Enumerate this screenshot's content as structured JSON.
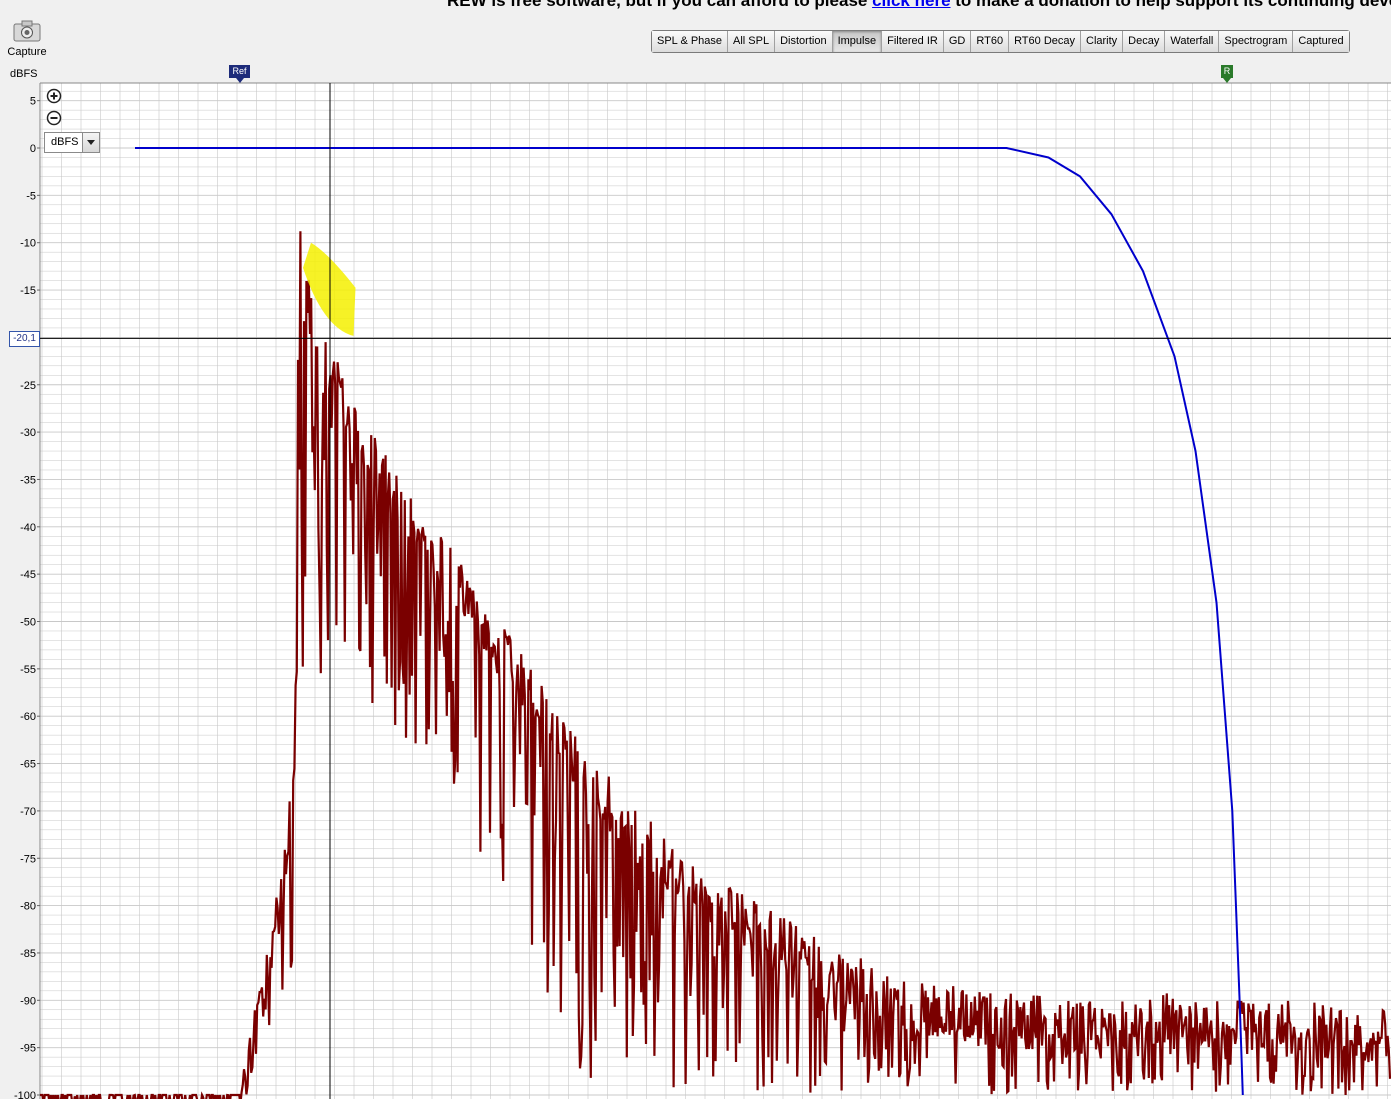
{
  "banner": {
    "text_before": "REW is free software, but if you can afford to please ",
    "link_text": "click here",
    "text_after": " to make a donation to help support its continuing develop"
  },
  "toolbar": {
    "capture_label": "Capture",
    "capture_icon": "camera-icon",
    "tabs": [
      {
        "label": "SPL & Phase",
        "active": false
      },
      {
        "label": "All SPL",
        "active": false
      },
      {
        "label": "Distortion",
        "active": false
      },
      {
        "label": "Impulse",
        "active": true
      },
      {
        "label": "Filtered IR",
        "active": false
      },
      {
        "label": "GD",
        "active": false
      },
      {
        "label": "RT60",
        "active": false
      },
      {
        "label": "RT60 Decay",
        "active": false
      },
      {
        "label": "Clarity",
        "active": false
      },
      {
        "label": "Decay",
        "active": false
      },
      {
        "label": "Waterfall",
        "active": false
      },
      {
        "label": "Spectrogram",
        "active": false
      },
      {
        "label": "Captured",
        "active": false
      }
    ]
  },
  "graph": {
    "unit_label": "dBFS",
    "unit_select_value": "dBFS",
    "cursor_readout": "-20,1",
    "ref_marker": "Ref",
    "right_marker": "R",
    "zoom_in_icon": "zoom-in-icon",
    "zoom_out_icon": "zoom-out-icon",
    "colors": {
      "trace": "#7a0000",
      "window": "#0000cc",
      "highlight": "#f5f000",
      "grid": "#c8c8c8",
      "cursor": "#000000"
    }
  },
  "chart_data": {
    "type": "line",
    "ylim": [
      -100,
      6
    ],
    "y_ticks": [
      "5",
      "0",
      "-5",
      "-10",
      "-15",
      "-20",
      "-25",
      "-30",
      "-35",
      "-40",
      "-45",
      "-50",
      "-55",
      "-60",
      "-65",
      "-70",
      "-75",
      "-80",
      "-85",
      "-90",
      "-95",
      "-100"
    ],
    "y_tick_values": [
      5,
      0,
      -5,
      -10,
      -15,
      -20,
      -25,
      -30,
      -35,
      -40,
      -45,
      -50,
      -55,
      -60,
      -65,
      -70,
      -75,
      -80,
      -85,
      -90,
      -95,
      -100
    ],
    "cursor_y": -20.1,
    "grid": true,
    "series": [
      {
        "type": "impulse-envelope",
        "upper": [
          [
            0,
            -100
          ],
          [
            0.05,
            -96
          ],
          [
            0.15,
            -90
          ],
          [
            0.3,
            -82
          ],
          [
            0.45,
            -72
          ],
          [
            0.52,
            -62
          ],
          [
            0.54,
            -45
          ],
          [
            0.56,
            -0.5
          ],
          [
            0.58,
            -8
          ],
          [
            0.62,
            -10
          ],
          [
            0.7,
            -18
          ],
          [
            0.8,
            -20
          ],
          [
            0.9,
            -22
          ],
          [
            1.0,
            -24
          ],
          [
            1.5,
            -34
          ],
          [
            2.0,
            -42
          ],
          [
            2.6,
            -52
          ],
          [
            3.2,
            -62
          ],
          [
            3.8,
            -70
          ],
          [
            4.4,
            -76
          ],
          [
            5.0,
            -80
          ],
          [
            5.6,
            -84
          ],
          [
            6.4,
            -88
          ],
          [
            7.2,
            -89
          ],
          [
            8.0,
            -90
          ],
          [
            9.0,
            -89
          ],
          [
            10.0,
            -90
          ],
          [
            11.0,
            -91
          ],
          [
            12.0,
            -92
          ]
        ],
        "lower": [
          [
            0,
            -100
          ],
          [
            0.1,
            -100
          ],
          [
            0.3,
            -96
          ],
          [
            0.5,
            -88
          ],
          [
            0.55,
            -60
          ],
          [
            0.6,
            -56
          ],
          [
            0.8,
            -58
          ],
          [
            1.0,
            -55
          ],
          [
            1.5,
            -62
          ],
          [
            2.0,
            -70
          ],
          [
            2.5,
            -80
          ],
          [
            3.0,
            -92
          ],
          [
            3.3,
            -100
          ],
          [
            12.0,
            -100
          ]
        ]
      },
      {
        "type": "window",
        "points": [
          [
            -1,
            0
          ],
          [
            7.3,
            0
          ],
          [
            7.7,
            -1
          ],
          [
            8.0,
            -3
          ],
          [
            8.3,
            -7
          ],
          [
            8.6,
            -13
          ],
          [
            8.9,
            -22
          ],
          [
            9.1,
            -32
          ],
          [
            9.3,
            -48
          ],
          [
            9.45,
            -70
          ],
          [
            9.52,
            -90
          ],
          [
            9.55,
            -100
          ]
        ]
      }
    ],
    "highlight": {
      "x_range": [
        0.6,
        1.1
      ],
      "y_range": [
        -19,
        -10
      ]
    }
  }
}
